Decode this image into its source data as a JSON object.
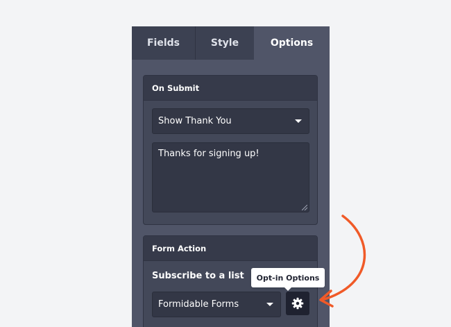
{
  "tabs": [
    {
      "label": "Fields"
    },
    {
      "label": "Style"
    },
    {
      "label": "Options"
    }
  ],
  "on_submit": {
    "heading": "On Submit",
    "action_select": "Show Thank You",
    "message": "Thanks for signing up!"
  },
  "form_action": {
    "heading": "Form Action",
    "subscribe_label": "Subscribe to a list",
    "list_select": "Formidable Forms",
    "options_icon": "gear-icon"
  },
  "tooltip": {
    "text": "Opt-in Options"
  },
  "colors": {
    "accent_arrow": "#f05a28",
    "panel": "#505568"
  }
}
